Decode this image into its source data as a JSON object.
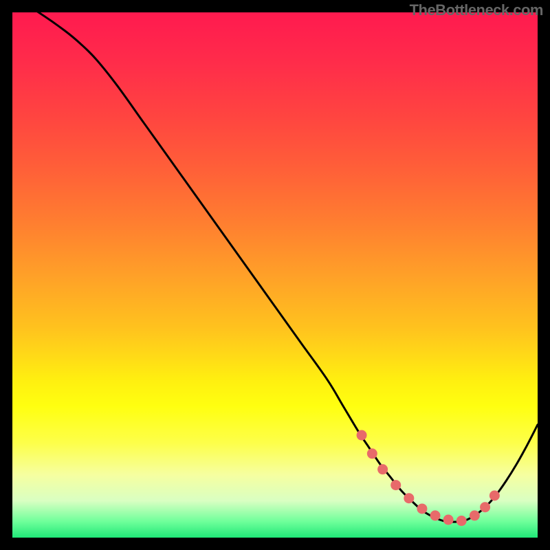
{
  "watermark": "TheBottleneck.com",
  "gradient": {
    "stops": [
      {
        "offset": 0.0,
        "color": "#ff1a4f"
      },
      {
        "offset": 0.1,
        "color": "#ff2d4a"
      },
      {
        "offset": 0.2,
        "color": "#ff4540"
      },
      {
        "offset": 0.3,
        "color": "#ff6038"
      },
      {
        "offset": 0.4,
        "color": "#ff7e30"
      },
      {
        "offset": 0.5,
        "color": "#ffa028"
      },
      {
        "offset": 0.6,
        "color": "#ffc21e"
      },
      {
        "offset": 0.65,
        "color": "#ffd818"
      },
      {
        "offset": 0.7,
        "color": "#ffef10"
      },
      {
        "offset": 0.75,
        "color": "#ffff10"
      },
      {
        "offset": 0.82,
        "color": "#fdff4a"
      },
      {
        "offset": 0.88,
        "color": "#f6ffa0"
      },
      {
        "offset": 0.93,
        "color": "#d9ffc2"
      },
      {
        "offset": 0.97,
        "color": "#6dff9a"
      },
      {
        "offset": 1.0,
        "color": "#20e878"
      }
    ]
  },
  "chart_data": {
    "type": "line",
    "title": "",
    "xlabel": "",
    "ylabel": "",
    "xlim": [
      0,
      100
    ],
    "ylim": [
      0,
      100
    ],
    "series": [
      {
        "name": "bottleneck-curve",
        "x": [
          0,
          5,
          10,
          13,
          16,
          20,
          25,
          30,
          35,
          40,
          45,
          50,
          55,
          60,
          63,
          66,
          68,
          70,
          72,
          74,
          76,
          78,
          80,
          82,
          84,
          86,
          88,
          90,
          92,
          94,
          96,
          98,
          100
        ],
        "y": [
          103,
          100,
          96.5,
          94,
          91,
          86,
          79,
          72,
          65,
          58,
          51,
          44,
          37,
          30,
          25,
          20,
          17,
          14,
          11.5,
          9.0,
          7.0,
          5.2,
          4.0,
          3.2,
          3.0,
          3.2,
          4.2,
          5.8,
          8.0,
          10.8,
          14.0,
          17.6,
          21.5
        ]
      }
    ],
    "markers": {
      "name": "highlight-dots",
      "color": "#e86a6a",
      "points": [
        {
          "x": 66.5,
          "y": 19.5
        },
        {
          "x": 68.5,
          "y": 16.0
        },
        {
          "x": 70.5,
          "y": 13.0
        },
        {
          "x": 73.0,
          "y": 10.0
        },
        {
          "x": 75.5,
          "y": 7.5
        },
        {
          "x": 78.0,
          "y": 5.5
        },
        {
          "x": 80.5,
          "y": 4.2
        },
        {
          "x": 83.0,
          "y": 3.4
        },
        {
          "x": 85.5,
          "y": 3.2
        },
        {
          "x": 88.0,
          "y": 4.2
        },
        {
          "x": 90.0,
          "y": 5.8
        },
        {
          "x": 91.8,
          "y": 8.0
        }
      ]
    }
  }
}
